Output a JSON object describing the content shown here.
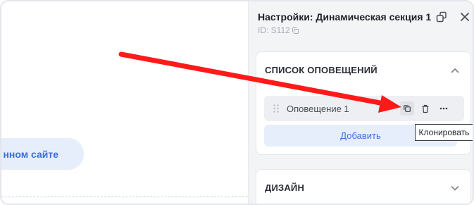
{
  "canvas": {
    "pill_text": "нном сайте"
  },
  "panel": {
    "title": "Настройки: Динамическая секция 1",
    "id_text": "ID: S112",
    "icons": {
      "popout": "popout-window-icon",
      "close": "close-icon",
      "copy_id": "copy-icon"
    }
  },
  "notifications_section": {
    "title": "СПИСОК ОПОВЕЩЕНИЙ",
    "expanded": true,
    "items": [
      {
        "label": "Оповещение 1",
        "actions": [
          "clone-icon",
          "trash-icon",
          "more-icon"
        ]
      }
    ],
    "add_label": "Добавить"
  },
  "design_section": {
    "title": "ДИЗАЙН",
    "expanded": false
  },
  "tooltip": {
    "text": "Клонировать"
  },
  "annotation": {
    "arrow_color": "#ff1a1a"
  },
  "colors": {
    "accent": "#3c6fd8",
    "accent_bg": "#e6eefb",
    "panel_bg": "#f3f4f6"
  }
}
